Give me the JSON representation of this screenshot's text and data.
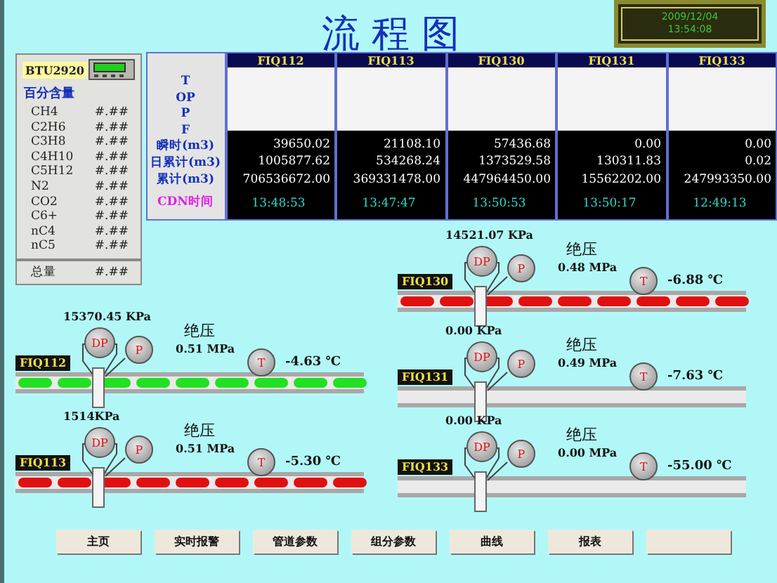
{
  "title": "流 程 图",
  "clock": {
    "date": "2009/12/04",
    "time": "13:54:08"
  },
  "analyzer": {
    "device": "BTU2920",
    "heading": "百分含量",
    "components": [
      {
        "name": "CH4",
        "value": "#.##"
      },
      {
        "name": "C2H6",
        "value": "#.##"
      },
      {
        "name": "C3H8",
        "value": "#.##"
      },
      {
        "name": "C4H10",
        "value": "#.##"
      },
      {
        "name": "C5H12",
        "value": "#.##"
      },
      {
        "name": "N2",
        "value": "#.##"
      },
      {
        "name": "CO2",
        "value": "#.##"
      },
      {
        "name": "C6+",
        "value": "#.##"
      },
      {
        "name": "nC4",
        "value": "#.##"
      },
      {
        "name": "nC5",
        "value": "#.##"
      }
    ],
    "total": {
      "name": "总量",
      "value": "#.##"
    }
  },
  "table": {
    "row_labels": [
      "T",
      "OP",
      "P",
      "F",
      "瞬时(m3)",
      "日累计(m3)",
      "累计(m3)",
      "CDN时间"
    ],
    "columns": [
      {
        "name": "FIQ112",
        "instant": "39650.02",
        "daily": "1005877.62",
        "total": "706536672.00",
        "time": "13:48:53"
      },
      {
        "name": "FIQ113",
        "instant": "21108.10",
        "daily": "534268.24",
        "total": "369331478.00",
        "time": "13:47:47"
      },
      {
        "name": "FIQ130",
        "instant": "57436.68",
        "daily": "1373529.58",
        "total": "447964450.00",
        "time": "13:50:53"
      },
      {
        "name": "FIQ131",
        "instant": "0.00",
        "daily": "130311.83",
        "total": "15562202.00",
        "time": "13:50:17"
      },
      {
        "name": "FIQ133",
        "instant": "0.00",
        "daily": "0.02",
        "total": "247993350.00",
        "time": "12:49:13"
      }
    ]
  },
  "pipes": [
    {
      "tag": "FIQ112",
      "dp": "15370.45 KPa",
      "abs_label": "绝压",
      "abs": "0.51 MPa",
      "temp": "-4.63 ℃",
      "color": "#22e022",
      "dp_badge": "DP",
      "p_badge": "P",
      "t_badge": "T"
    },
    {
      "tag": "FIQ113",
      "dp": "1514KPa",
      "abs_label": "绝压",
      "abs": "0.51 MPa",
      "temp": "-5.30 ℃",
      "color": "#e01010",
      "dp_badge": "DP",
      "p_badge": "P",
      "t_badge": "T"
    },
    {
      "tag": "FIQ130",
      "dp": "14521.07 KPa",
      "abs_label": "绝压",
      "abs": "0.48 MPa",
      "temp": "-6.88 ℃",
      "color": "#e01010",
      "dp_badge": "DP",
      "p_badge": "P",
      "t_badge": "T"
    },
    {
      "tag": "FIQ131",
      "dp": "0.00 KPa",
      "abs_label": "绝压",
      "abs": "0.49 MPa",
      "temp": "-7.63 ℃",
      "dp_badge": "DP",
      "p_badge": "P",
      "t_badge": "T"
    },
    {
      "tag": "FIQ133",
      "dp": "0.00 KPa",
      "abs_label": "绝压",
      "abs": "0.00 MPa",
      "temp": "-55.00 ℃",
      "dp_badge": "DP",
      "p_badge": "P",
      "t_badge": "T"
    }
  ],
  "buttons": [
    {
      "kind": "labeled",
      "label": "主页"
    },
    {
      "kind": "labeled",
      "label": "实时报警"
    },
    {
      "kind": "labeled",
      "label": "管道参数"
    },
    {
      "kind": "labeled",
      "label": "组分参数"
    },
    {
      "kind": "labeled",
      "label": "曲线"
    },
    {
      "kind": "labeled",
      "label": "报表"
    },
    {
      "kind": "blank"
    }
  ]
}
